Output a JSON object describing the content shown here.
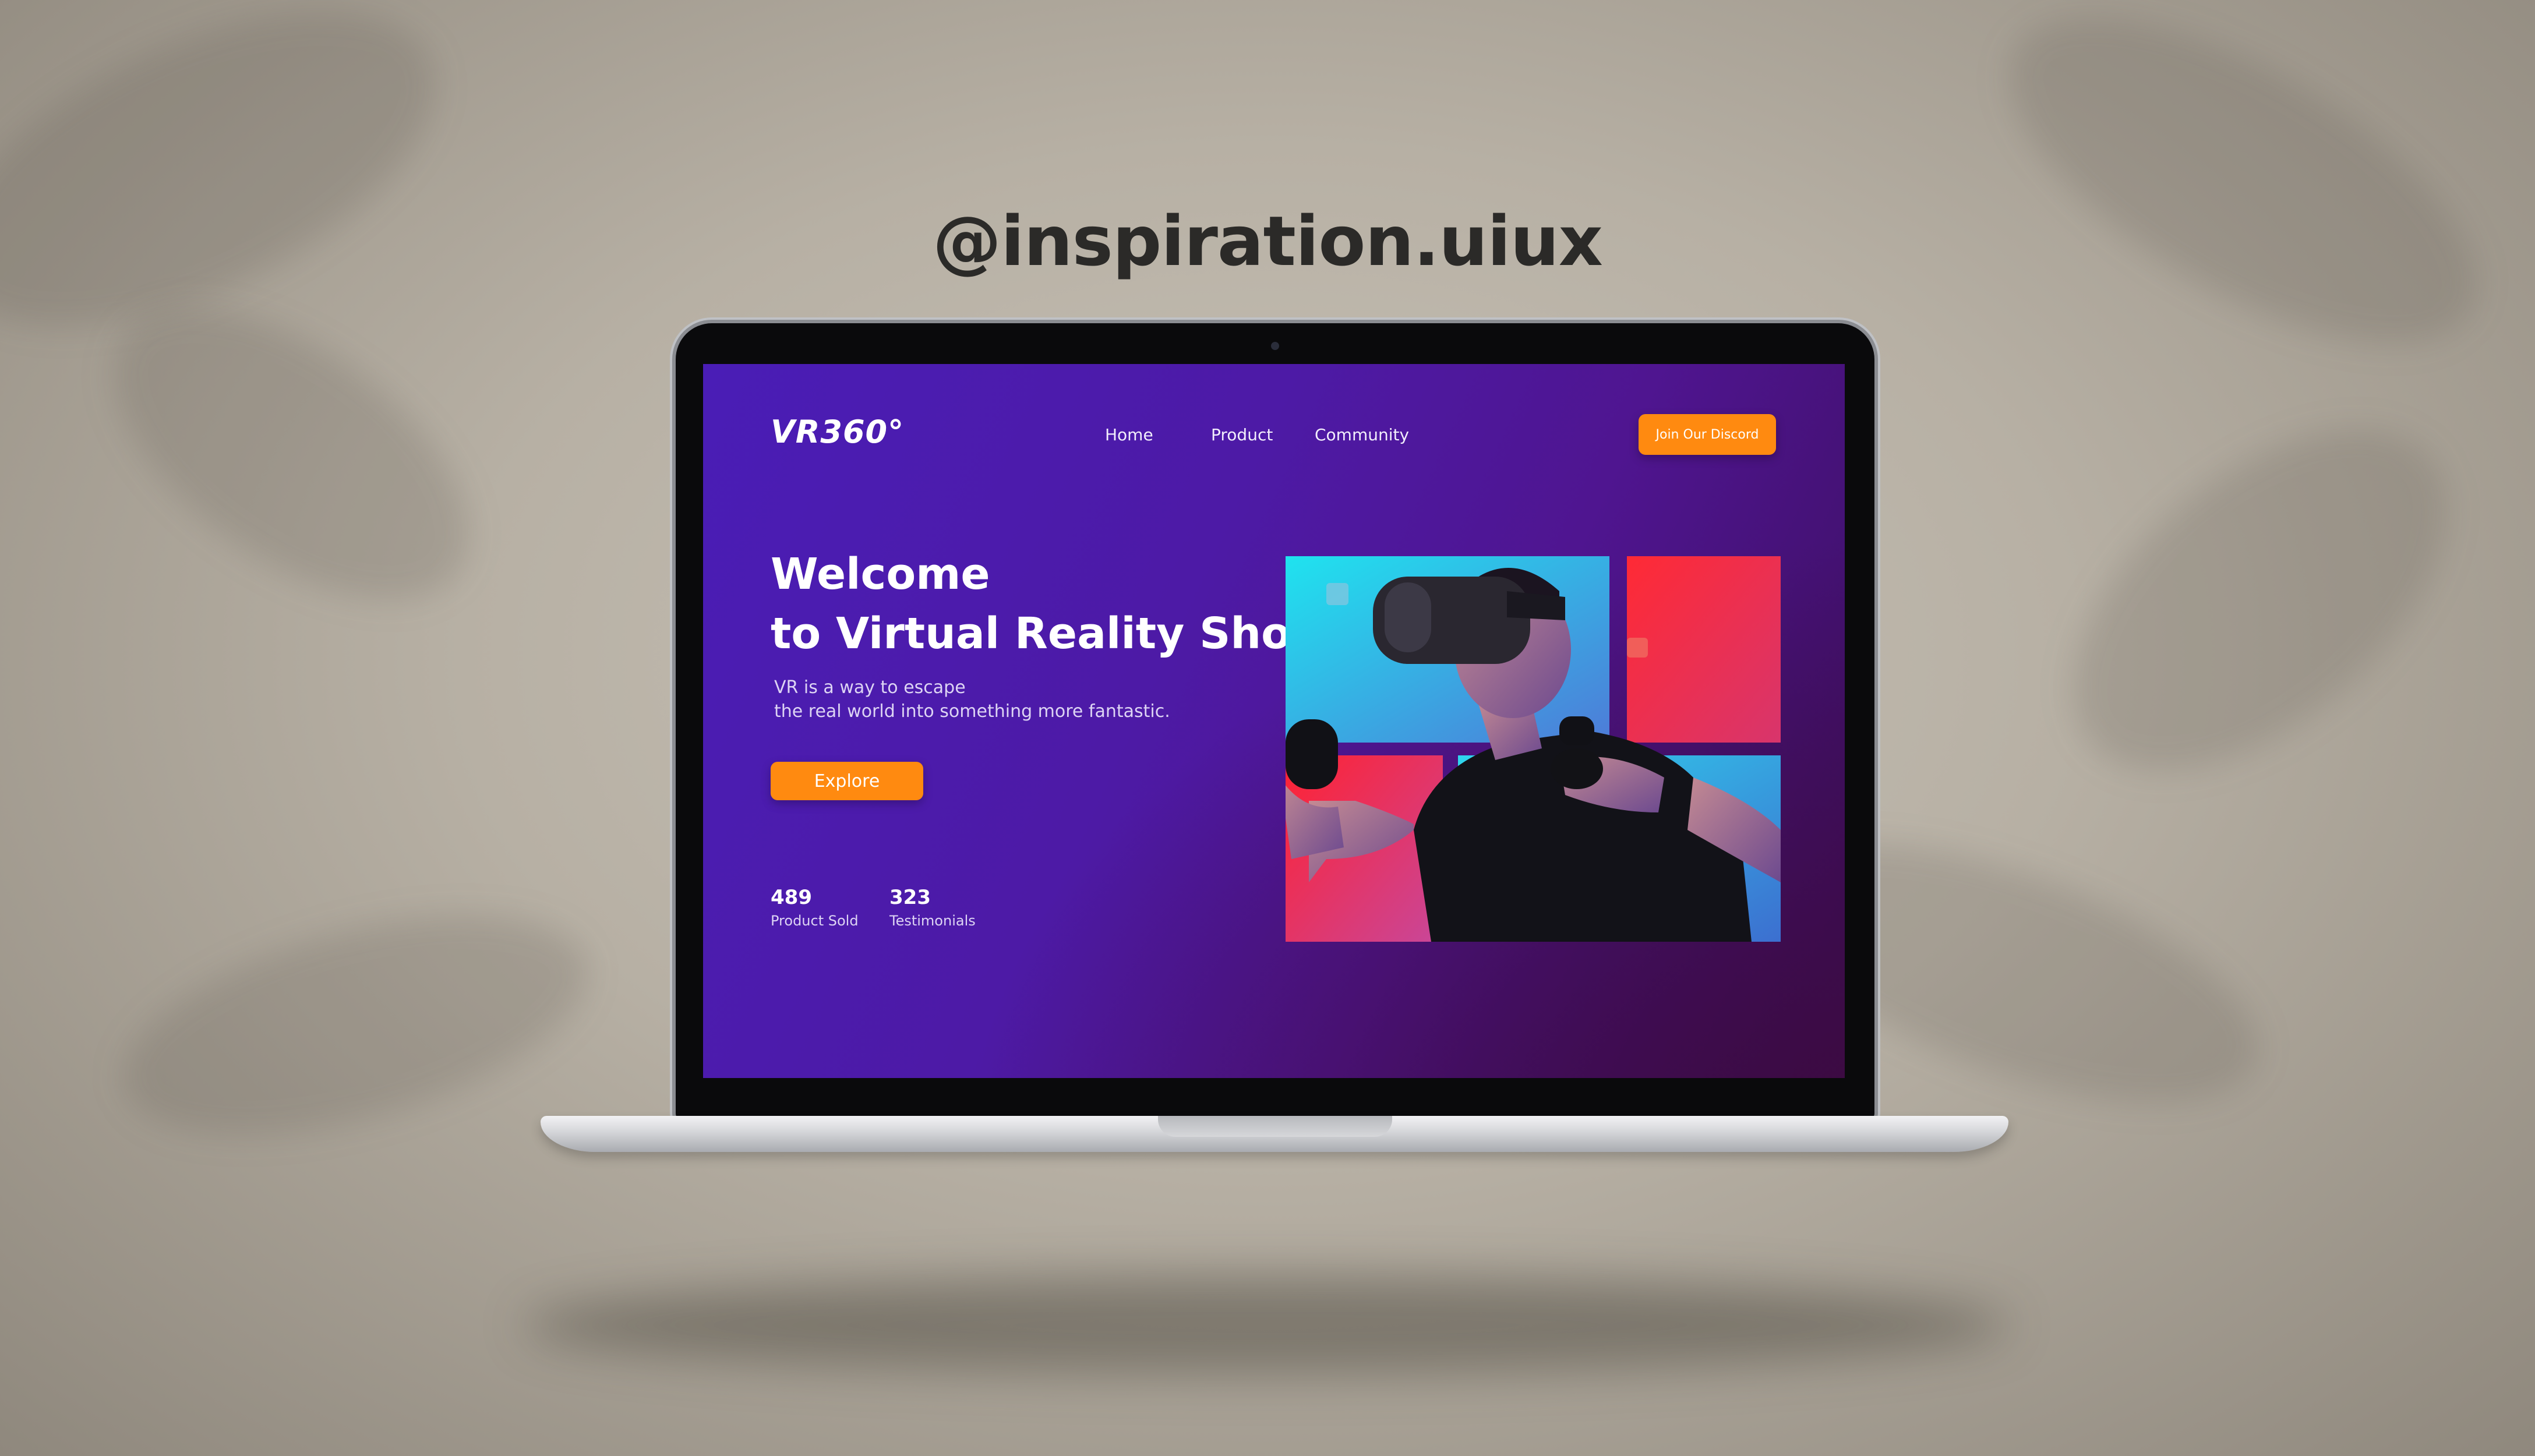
{
  "watermark": "@inspiration.uiux",
  "site": {
    "logo": "VR360°",
    "nav": [
      {
        "label": "Home"
      },
      {
        "label": "Product"
      },
      {
        "label": "Community"
      }
    ],
    "cta_label": "Join Our Discord",
    "hero": {
      "title_line1": "Welcome",
      "title_line2": "to Virtual Reality Shop",
      "subtitle_line1": "VR is a way to escape",
      "subtitle_line2": "the real world into something more fantastic.",
      "button_label": "Explore"
    },
    "stats": [
      {
        "value": "489",
        "label": "Product Sold"
      },
      {
        "value": "323",
        "label": "Testimonials"
      }
    ]
  },
  "colors": {
    "accent": "#ff8a10",
    "screen_bg_start": "#4a1db6",
    "screen_bg_end": "#3c0a3f",
    "tile_cyan": "#1fe3ef",
    "tile_red": "#ff2a35"
  },
  "image": {
    "icon": "person-with-vr-headset-image"
  }
}
